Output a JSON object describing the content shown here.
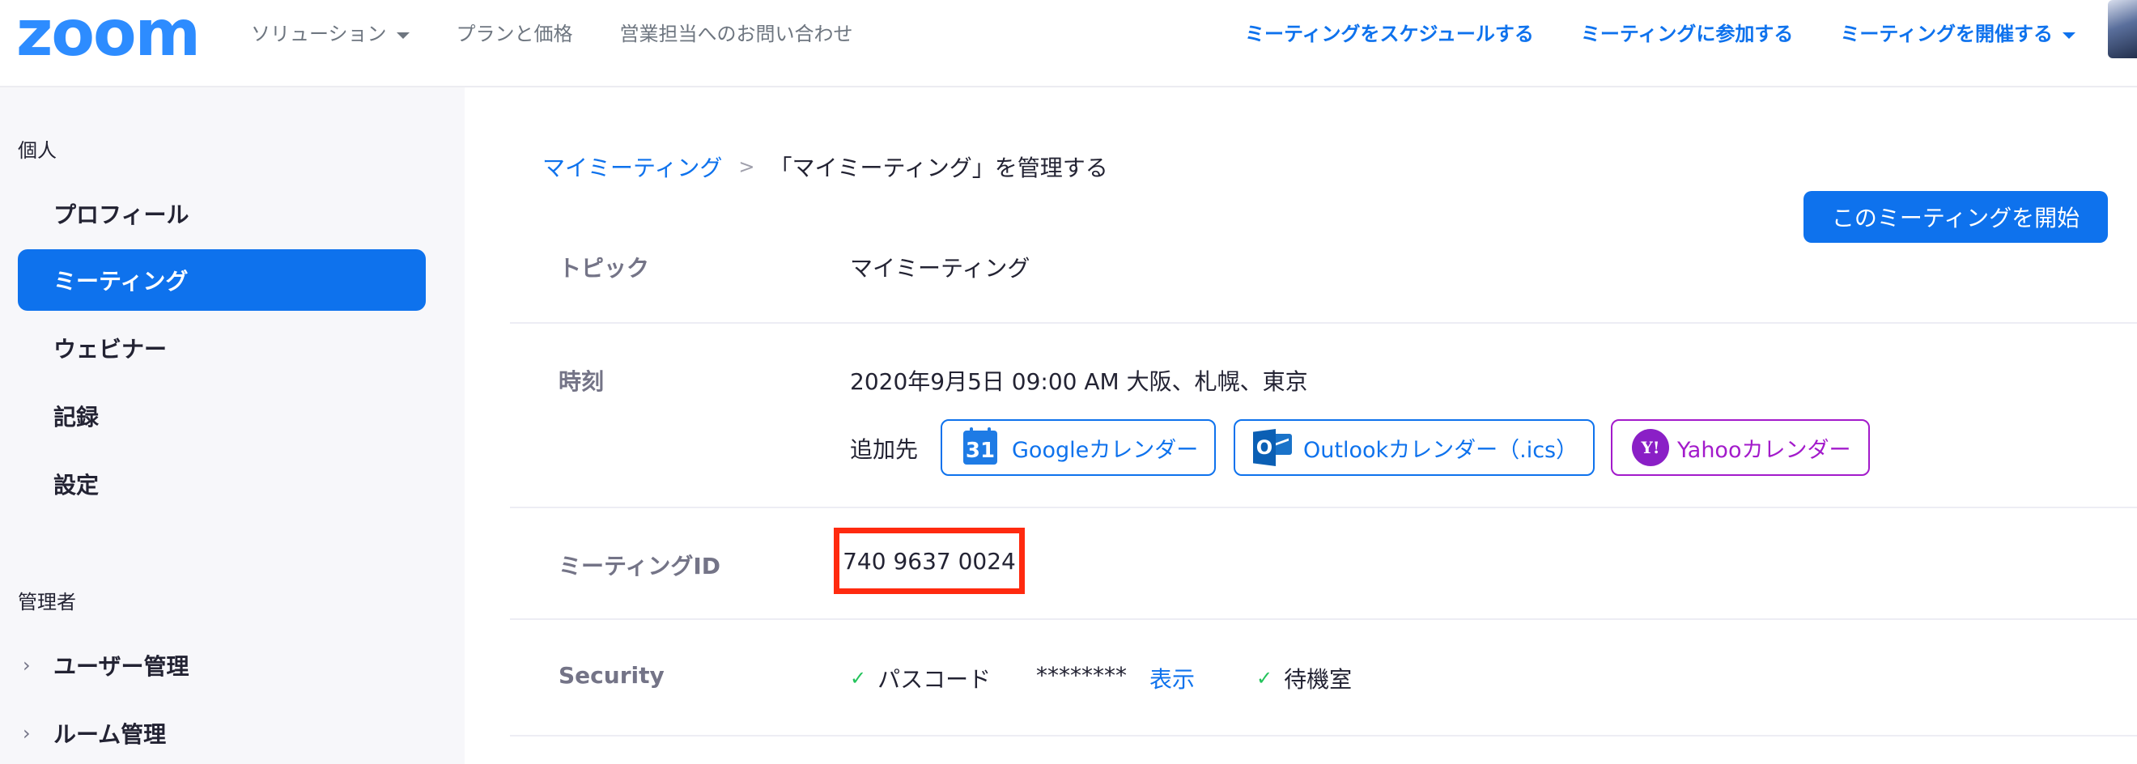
{
  "brand": {
    "logo_text": "zoom",
    "accent": "#0e72ed",
    "highlight": "#ff2a0f"
  },
  "topnav": {
    "left": [
      {
        "label": "ソリューション",
        "dropdown": true
      },
      {
        "label": "プランと価格",
        "dropdown": false
      },
      {
        "label": "営業担当へのお問い合わせ",
        "dropdown": false
      }
    ],
    "right": [
      {
        "label": "ミーティングをスケジュールする",
        "dropdown": false
      },
      {
        "label": "ミーティングに参加する",
        "dropdown": false
      },
      {
        "label": "ミーティングを開催する",
        "dropdown": true
      }
    ]
  },
  "sidebar": {
    "personal_header": "個人",
    "personal_items": [
      {
        "label": "プロフィール",
        "active": false
      },
      {
        "label": "ミーティング",
        "active": true
      },
      {
        "label": "ウェビナー",
        "active": false
      },
      {
        "label": "記録",
        "active": false
      },
      {
        "label": "設定",
        "active": false
      }
    ],
    "admin_header": "管理者",
    "admin_items": [
      {
        "label": "ユーザー管理",
        "chevron": "›"
      },
      {
        "label": "ルーム管理",
        "chevron": "›"
      }
    ]
  },
  "breadcrumb": {
    "parent": "マイミーティング",
    "separator": ">",
    "current": "「マイミーティング」を管理する"
  },
  "start_button": "このミーティングを開始",
  "details": {
    "topic": {
      "label": "トピック",
      "value": "マイミーティング"
    },
    "time": {
      "label": "時刻",
      "value": "2020年9月5日 09:00 AM 大阪、札幌、東京",
      "add_to_label": "追加先",
      "calendars": [
        {
          "label": "Googleカレンダー",
          "icon": "google-calendar-icon",
          "icon_text": "31",
          "color": "#0e72ed"
        },
        {
          "label": "Outlookカレンダー（.ics）",
          "icon": "outlook-icon",
          "icon_text": "O",
          "color": "#0e72ed"
        },
        {
          "label": "Yahooカレンダー",
          "icon": "yahoo-icon",
          "icon_text": "Y!",
          "color": "#a31bcb"
        }
      ]
    },
    "meeting_id": {
      "label": "ミーティングID",
      "value": "740 9637 0024"
    },
    "security": {
      "label": "Security",
      "passcode_label": "パスコード",
      "passcode_mask": "********",
      "show_link": "表示",
      "waiting_room_label": "待機室"
    }
  }
}
